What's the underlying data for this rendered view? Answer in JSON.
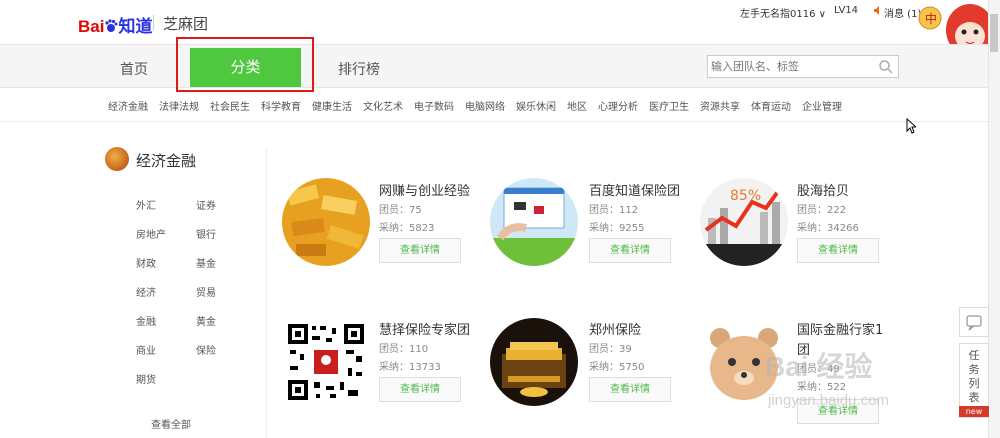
{
  "header": {
    "logo_red": "Bai",
    "logo_blue": "知道",
    "site_name": "芝麻团",
    "user": "左手无名指0116 ∨",
    "level": "LV14",
    "messages": "消息 (1)"
  },
  "nav": {
    "home": "首页",
    "category": "分类",
    "ranking": "排行榜",
    "search_placeholder": "输入团队名、标签"
  },
  "categories": [
    "经济金融",
    "法律法规",
    "社会民生",
    "科学教育",
    "健康生活",
    "文化艺术",
    "电子数码",
    "电脑网络",
    "娱乐休闲",
    "地区",
    "心理分析",
    "医疗卫生",
    "资源共享",
    "体育运动",
    "企业管理"
  ],
  "sidebar": {
    "title": "经济金融",
    "items": [
      "外汇",
      "证券",
      "房地产",
      "银行",
      "财政",
      "基金",
      "经济",
      "贸易",
      "金融",
      "黄金",
      "商业",
      "保险",
      "期货"
    ],
    "view_all": "查看全部"
  },
  "cards": [
    {
      "title": "网赚与创业经验",
      "members": "团员：75",
      "adopted": "采纳：5823",
      "button": "查看详情"
    },
    {
      "title": "百度知道保险团",
      "members": "团员：112",
      "adopted": "采纳：9255",
      "button": "查看详情"
    },
    {
      "title": "股海拾贝",
      "members": "团员：222",
      "adopted": "采纳：34266",
      "button": "查看详情"
    },
    {
      "title": "慧择保险专家团",
      "members": "团员：110",
      "adopted": "采纳：13733",
      "button": "查看详情"
    },
    {
      "title": "郑州保险",
      "members": "团员：39",
      "adopted": "采纳：5750",
      "button": "查看详情"
    },
    {
      "title": "国际金融行家1",
      "title2": "团",
      "members": "团员：49",
      "adopted": "采纳：522",
      "button": "查看详情"
    }
  ],
  "right_panel": {
    "task_list": [
      "任",
      "务",
      "列",
      "表"
    ],
    "new_badge": "new"
  },
  "watermark": {
    "text": "Bai 经验",
    "url": "jingyan.baidu.com"
  },
  "colors": {
    "accent": "#4fc73f",
    "highlight_box": "#e0191b",
    "brand_red": "#e10601",
    "brand_blue": "#2932e1"
  }
}
